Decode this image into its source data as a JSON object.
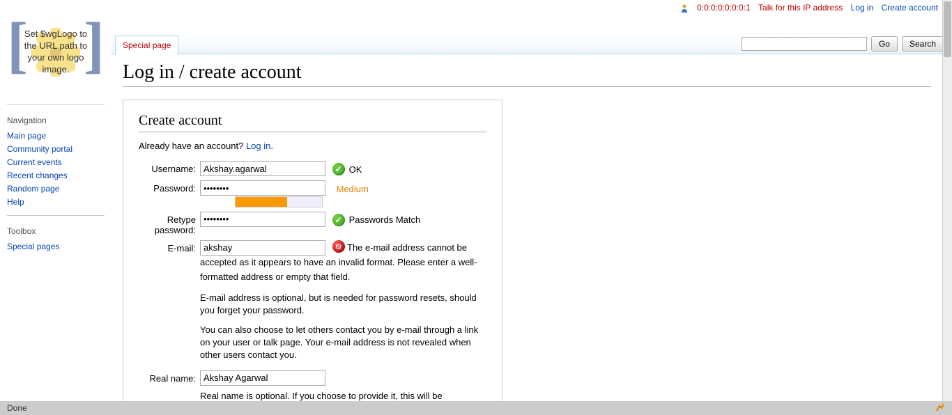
{
  "topLinks": {
    "ip": "0:0:0:0:0:0:0:1",
    "talk": "Talk for this IP address",
    "login": "Log in",
    "create": "Create account"
  },
  "logo": {
    "text": "Set $wgLogo to the URL path to your own logo image."
  },
  "sidebar": {
    "navHeading": "Navigation",
    "navItems": [
      "Main page",
      "Community portal",
      "Current events",
      "Recent changes",
      "Random page",
      "Help"
    ],
    "toolHeading": "Toolbox",
    "toolItems": [
      "Special pages"
    ]
  },
  "tab": "Special page",
  "search": {
    "go": "Go",
    "search": "Search"
  },
  "page": {
    "title": "Log in / create account",
    "boxTitle": "Create account",
    "alreadyText": "Already have an account? ",
    "alreadyLink": "Log in",
    "alreadyPeriod": "."
  },
  "form": {
    "usernameLabel": "Username:",
    "usernameValue": "Akshay.agarwal",
    "usernameStatus": "OK",
    "passwordLabel": "Password:",
    "passwordValue": "••••••••",
    "passwordStrength": "Medium",
    "retypeLabel": "Retype password:",
    "retypeValue": "••••••••",
    "retypeStatus": "Passwords Match",
    "emailLabel": "E-mail:",
    "emailValue": "akshay",
    "emailError": "The e-mail address cannot be accepted as it appears to have an invalid format. Please enter a well-formatted address or empty that field.",
    "emailHelp1": "E-mail address is optional, but is needed for password resets, should you forget your password.",
    "emailHelp2": "You can also choose to let others contact you by e-mail through a link on your user or talk page. Your e-mail address is not revealed when other users contact you.",
    "realnameLabel": "Real name:",
    "realnameValue": "Akshay Agarwal",
    "realnameHelp": "Real name is optional. If you choose to provide it, this will be"
  },
  "statusbar": {
    "text": "Done"
  }
}
